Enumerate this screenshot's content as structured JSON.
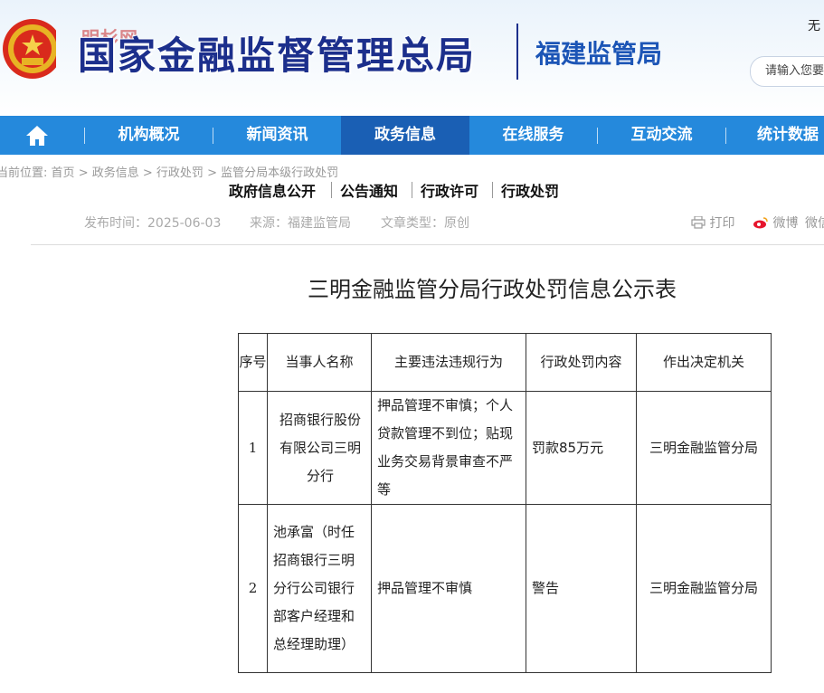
{
  "header": {
    "org_title": "国家金融监督管理总局",
    "branch_title": "福建监管局",
    "access_label": "无",
    "search_placeholder": "请输入您要",
    "watermark": "明杉网"
  },
  "nav": {
    "items": [
      "机构概况",
      "新闻资讯",
      "政务信息",
      "在线服务",
      "互动交流",
      "统计数据"
    ],
    "active_index": 2,
    "active_color": "#1a5fb4",
    "bar_color": "#2589dc"
  },
  "breadcrumb": {
    "prefix": "当前位置:",
    "items": [
      "首页",
      "政务信息",
      "行政处罚",
      "监管分局本级行政处罚"
    ]
  },
  "sub_nav": [
    "政府信息公开",
    "公告通知",
    "行政许可",
    "行政处罚"
  ],
  "meta": {
    "publish_time": "发布时间：2025-06-03",
    "source": "来源：福建监管局",
    "doc_type": "文章类型：原创",
    "print": "打印",
    "weibo": "微博",
    "wechat": "微信"
  },
  "document": {
    "title": "三明金融监管分局行政处罚信息公示表"
  },
  "table": {
    "headers": [
      "序号",
      "当事人名称",
      "主要违法违规行为",
      "行政处罚内容",
      "作出决定机关"
    ],
    "rows": [
      {
        "index": "1",
        "party": "招商银行股份有限公司三明分行",
        "violation": "押品管理不审慎；个人贷款管理不到位；贴现业务交易背景审查不严等",
        "penalty": "罚款85万元",
        "authority": "三明金融监管分局"
      },
      {
        "index": "2",
        "party": "池承富（时任招商银行三明分行公司银行部客户经理和总经理助理）",
        "violation": "押品管理不审慎",
        "penalty": "警告",
        "authority": "三明金融监管分局"
      }
    ]
  }
}
